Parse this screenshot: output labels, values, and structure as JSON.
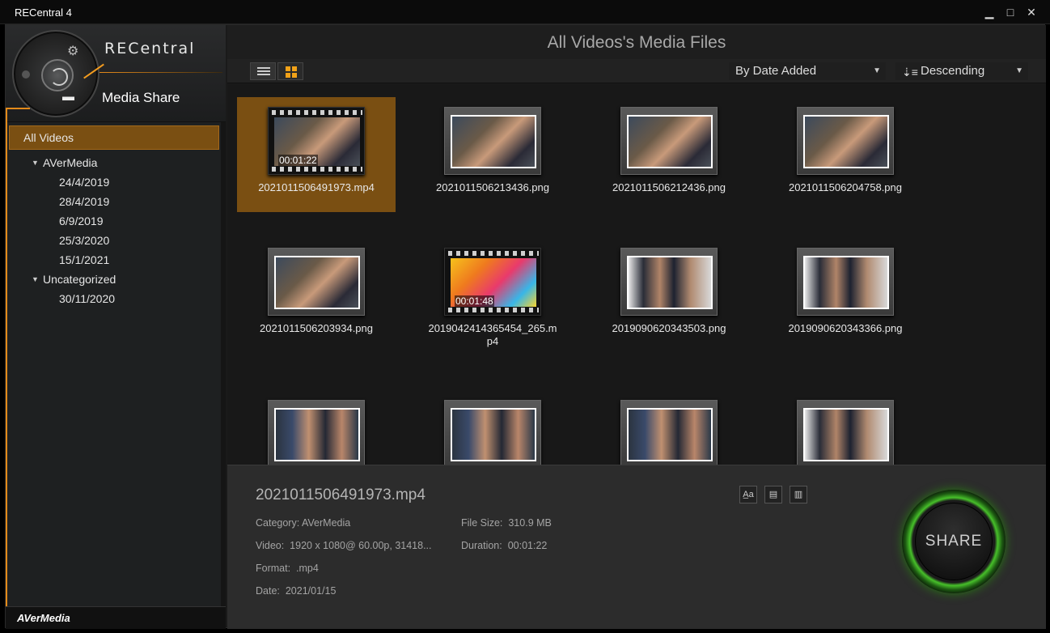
{
  "app": {
    "title": "RECentral 4"
  },
  "window_controls": {
    "minimize": "▁",
    "maximize": "□",
    "close": "✕"
  },
  "sidebar": {
    "brand": "RECentral",
    "mode_title": "Media Share",
    "tree": [
      {
        "label": "All Videos",
        "type": "root",
        "selected": true
      },
      {
        "label": "AVerMedia",
        "type": "group"
      },
      {
        "label": "24/4/2019",
        "type": "child"
      },
      {
        "label": "28/4/2019",
        "type": "child"
      },
      {
        "label": "6/9/2019",
        "type": "child"
      },
      {
        "label": "25/3/2020",
        "type": "child"
      },
      {
        "label": "15/1/2021",
        "type": "child"
      },
      {
        "label": "Uncategorized",
        "type": "group"
      },
      {
        "label": "30/11/2020",
        "type": "child"
      }
    ],
    "footer_logo": "AVerMedia"
  },
  "main": {
    "title": "All Videos's Media Files",
    "sort_by": "By Date Added",
    "sort_order": "Descending",
    "files": [
      {
        "name": "2021011506491973.mp4",
        "type": "video",
        "duration": "00:01:22",
        "selected": true
      },
      {
        "name": "2021011506213436.png",
        "type": "image"
      },
      {
        "name": "2021011506212436.png",
        "type": "image"
      },
      {
        "name": "2021011506204758.png",
        "type": "image"
      },
      {
        "name": "2021011506203934.png",
        "type": "image"
      },
      {
        "name": "2019042414365454_265.mp4",
        "type": "video",
        "duration": "00:01:48"
      },
      {
        "name": "2019090620343503.png",
        "type": "image"
      },
      {
        "name": "2019090620343366.png",
        "type": "image"
      },
      {
        "name": "",
        "type": "image"
      },
      {
        "name": "",
        "type": "image"
      },
      {
        "name": "",
        "type": "image"
      },
      {
        "name": "",
        "type": "image"
      }
    ]
  },
  "details": {
    "filename": "2021011506491973.mp4",
    "category_label": "Category:",
    "category": "AVerMedia",
    "video_label": "Video:",
    "video": "1920 x 1080@ 60.00p, 31418...",
    "format_label": "Format:",
    "format": ".mp4",
    "date_label": "Date:",
    "date": "2021/01/15",
    "filesize_label": "File Size:",
    "filesize": "310.9 MB",
    "duration_label": "Duration:",
    "duration": "00:01:22",
    "share_label": "SHARE"
  },
  "colors": {
    "accent": "#e38a1a",
    "selected_bg": "#7a4f12",
    "share_ring": "#47c02a"
  }
}
